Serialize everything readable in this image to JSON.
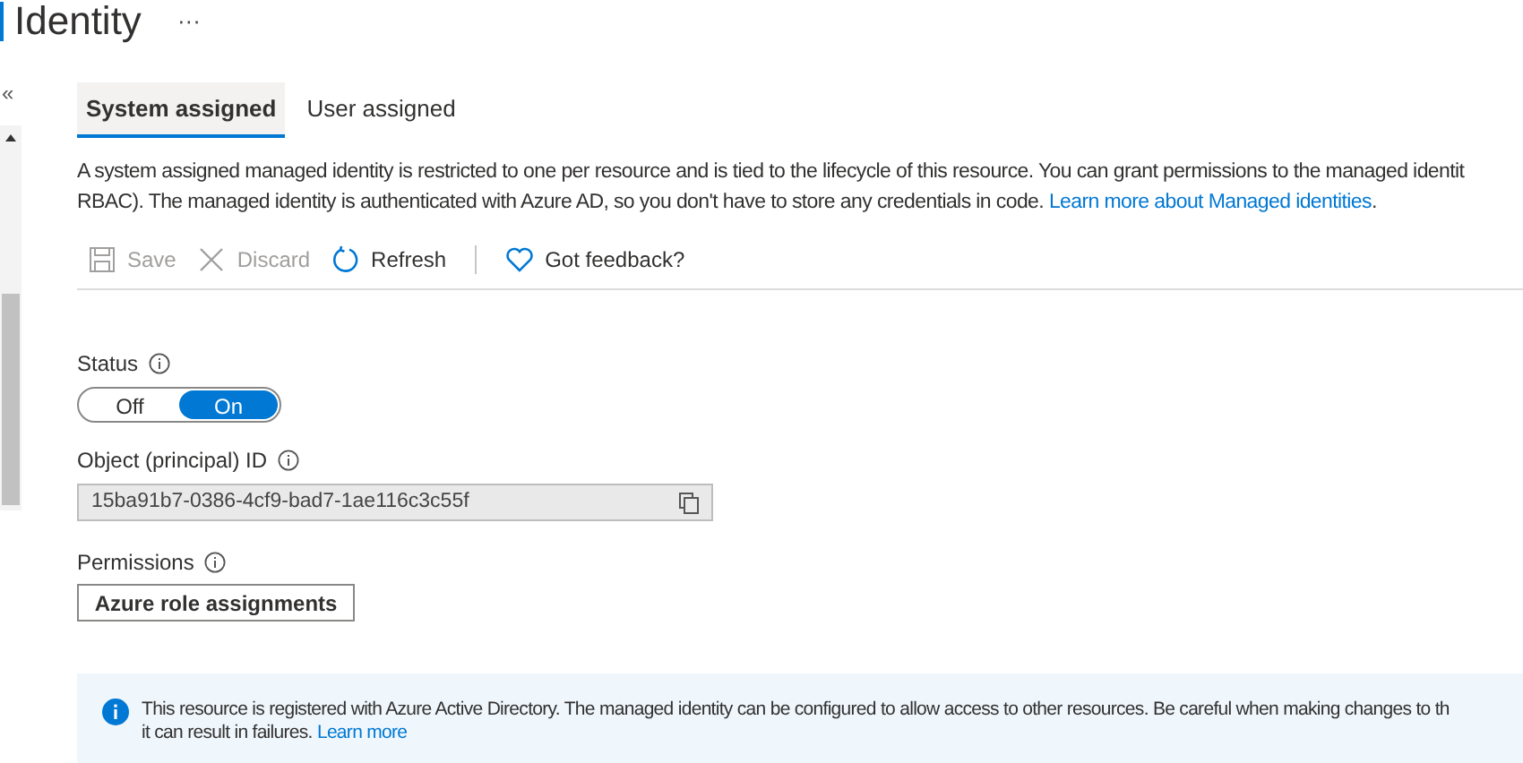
{
  "header": {
    "title": "Identity",
    "more": "···"
  },
  "sidebar": {
    "collapse": "«"
  },
  "tabs": [
    {
      "label": "System assigned",
      "selected": true
    },
    {
      "label": "User assigned",
      "selected": false
    }
  ],
  "description": {
    "lines": [
      "A system assigned managed identity is restricted to one per resource and is tied to the lifecycle of this resource. You can grant permissions to the managed identit",
      "RBAC). The managed identity is authenticated with Azure AD, so you don't have to store any credentials in code."
    ],
    "link": "Learn more about Managed identities",
    "after": "."
  },
  "toolbar": [
    {
      "kind": "save",
      "label": "Save",
      "disabled": true
    },
    {
      "kind": "discard",
      "label": "Discard",
      "disabled": true
    },
    {
      "kind": "refresh",
      "label": "Refresh",
      "disabled": false
    },
    {
      "kind": "feedback",
      "label": "Got feedback?",
      "disabled": false
    }
  ],
  "status": {
    "label": "Status",
    "options": [
      {
        "label": "Off",
        "selected": false
      },
      {
        "label": "On",
        "selected": true
      }
    ]
  },
  "object_id": {
    "label": "Object (principal) ID",
    "value": "15ba91b7-0386-4cf9-bad7-1ae116c3c55f"
  },
  "permissions": {
    "label": "Permissions",
    "button": "Azure role assignments"
  },
  "info": {
    "lines": [
      "This resource is registered with Azure Active Directory. The managed identity can be configured to allow access to other resources. Be careful when making changes to th",
      "it can result in failures."
    ],
    "link": "Learn more"
  }
}
